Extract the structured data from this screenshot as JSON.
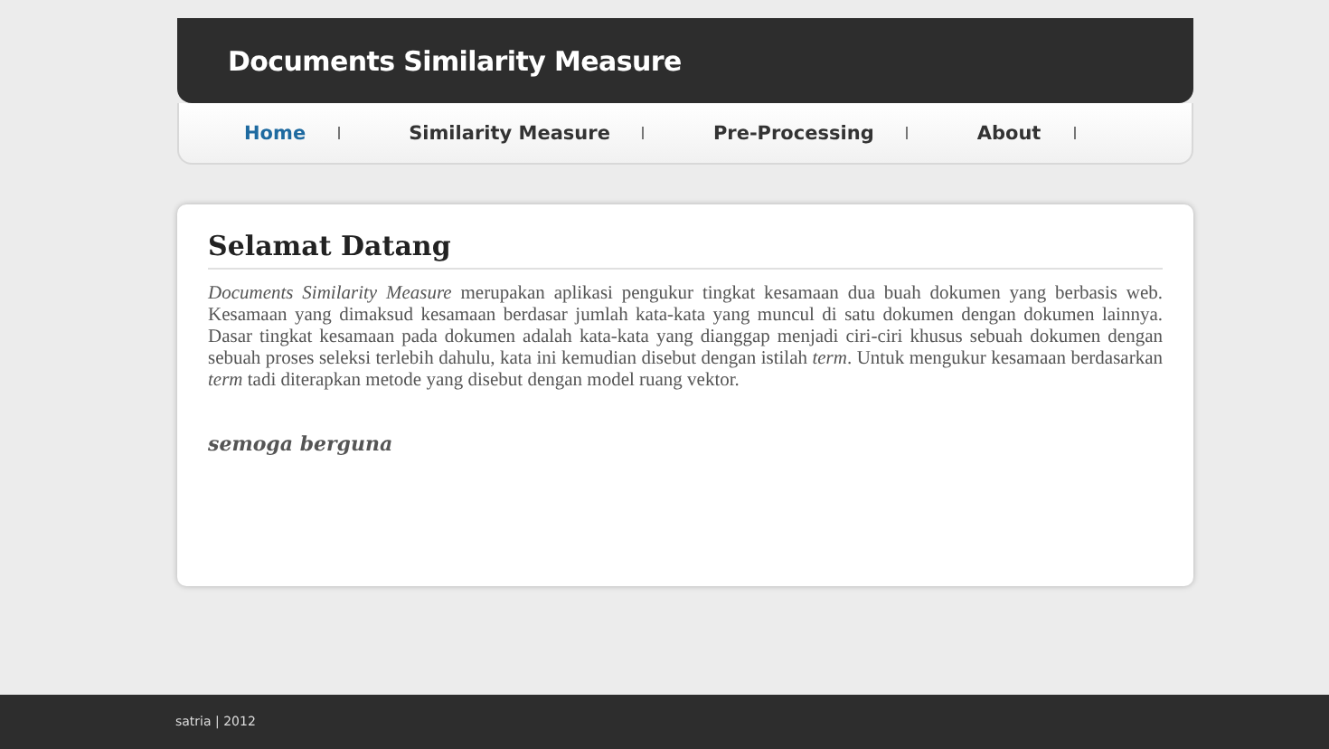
{
  "header": {
    "title": "Documents Similarity Measure"
  },
  "nav": [
    {
      "label": "Home",
      "selected": true
    },
    {
      "label": "Similarity Measure",
      "selected": false
    },
    {
      "label": "Pre-Processing",
      "selected": false
    },
    {
      "label": "About",
      "selected": false
    }
  ],
  "content": {
    "heading": "Selamat Datang",
    "paragraph": "*Documents Similarity Measure* merupakan aplikasi pengukur tingkat kesamaan dua buah dokumen yang berbasis web. Kesamaan yang dimaksud kesamaan berdasar jumlah kata-kata yang muncul di satu dokumen dengan dokumen lainnya. Dasar tingkat kesamaan pada dokumen adalah kata-kata yang dianggap menjadi ciri-ciri khusus sebuah dokumen dengan sebuah proses seleksi terlebih dahulu, kata ini kemudian disebut dengan istilah *term*. Untuk mengukur kesamaan berdasarkan *term* tadi diterapkan metode yang disebut dengan model ruang vektor.",
    "closing": "semoga berguna"
  },
  "footer": {
    "text": "satria | 2012"
  }
}
